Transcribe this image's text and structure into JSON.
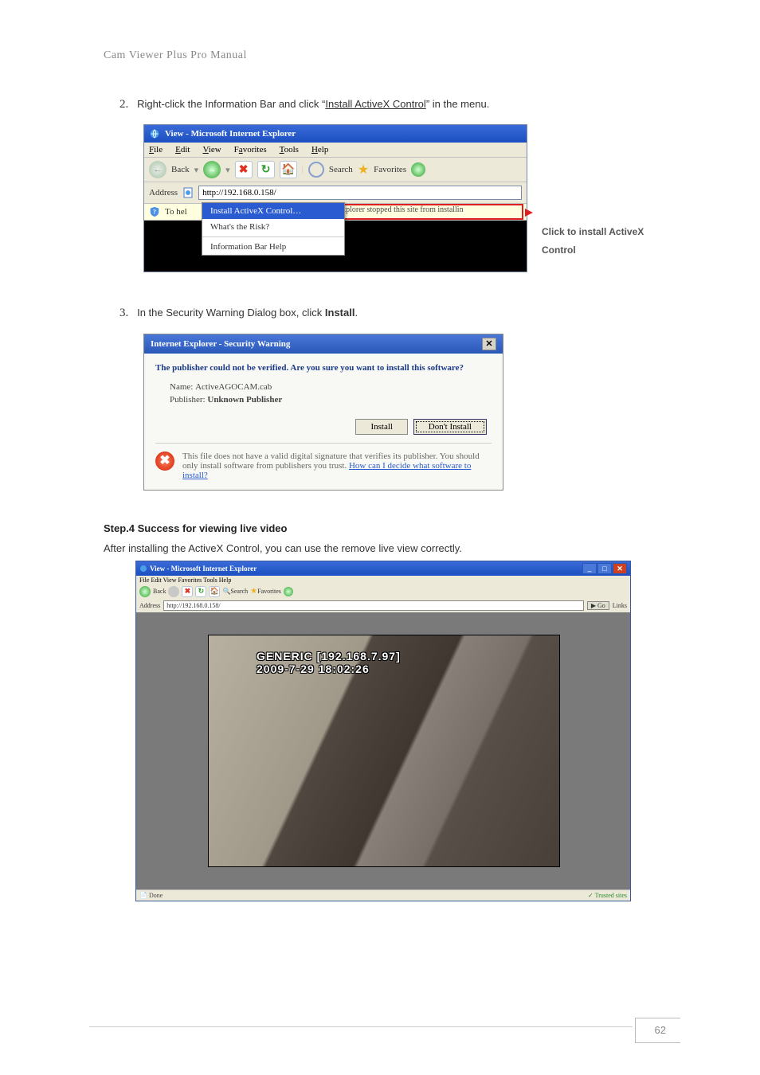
{
  "header": "Cam Viewer Plus Pro Manual",
  "step2": {
    "num": "2.",
    "pre": "Right-click the Information Bar and click “",
    "link": "Install ActiveX Control",
    "post": "” in the ",
    "tail": "menu",
    "dot": "."
  },
  "ie1": {
    "title": "View - Microsoft Internet Explorer",
    "menus": {
      "file": "File",
      "edit": "Edit",
      "view": "View",
      "fav": "Favorites",
      "tools": "Tools",
      "help": "Help"
    },
    "toolbar": {
      "back": "Back",
      "search": "Search",
      "fav": "Favorites"
    },
    "address_label": "Address",
    "url": "http://192.168.0.158/",
    "infobar_prefix": "To hel",
    "ctx": {
      "install": "Install ActiveX Control…",
      "risk": "What's the Risk?",
      "help": "Information Bar Help"
    },
    "blocked": "Explorer stopped this site from installin"
  },
  "callout": {
    "l1": "Click to install ActiveX",
    "l2": "Control"
  },
  "step3": {
    "num": "3.",
    "text": "In the Security Warning Dialog box, click ",
    "bold": "Install",
    "dot": "."
  },
  "sec": {
    "title": "Internet Explorer - Security Warning",
    "q": "The publisher could not be verified.  Are you sure you want to install this software?",
    "name_lbl": "Name:",
    "name_val": "ActiveAGOCAM.cab",
    "pub_lbl": "Publisher:",
    "pub_val": "Unknown Publisher",
    "install": "Install",
    "dont": "Don't Install",
    "warn1": "This file does not have a valid digital signature that verifies its publisher. You should only install software from publishers you trust. ",
    "warn_link": "How can I decide what software to install?"
  },
  "step4_title": "Step.4 Success for viewing live video",
  "step4_text": "After installing the ActiveX Control, you can use the remove live view correctly.",
  "ie2": {
    "title": "View - Microsoft Internet Explorer",
    "menus": "File  Edit  View  Favorites  Tools  Help",
    "addr_lbl": "Address",
    "url": "http://192.168.0.158/",
    "go": "Go",
    "links": "Links",
    "overlay_l1": "GENERIC [192.168.7.97]",
    "overlay_l2": "2009-7-29 18:02:26",
    "status_done": "Done",
    "status_trust": "Trusted sites"
  },
  "page_number": "62"
}
